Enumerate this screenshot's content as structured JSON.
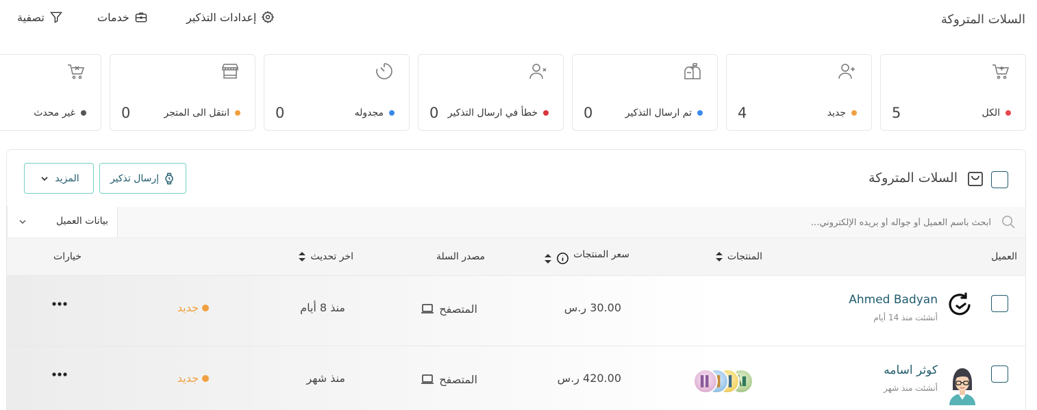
{
  "header": {
    "title": "السلات المتروكة",
    "actions": [
      {
        "label": "إعدادات التذكير",
        "icon": "gear-icon"
      },
      {
        "label": "خدمات",
        "icon": "briefcase-icon"
      },
      {
        "label": "تصفية",
        "icon": "filter-icon"
      }
    ]
  },
  "stats": [
    {
      "label": "الكل",
      "count": "5",
      "dot_color": "#e8474e",
      "icon": "cart-plus-icon"
    },
    {
      "label": "جديد",
      "count": "4",
      "dot_color": "#f0a040",
      "icon": "user-plus-icon"
    },
    {
      "label": "تم ارسال التذكير",
      "count": "0",
      "dot_color": "#3b8be6",
      "icon": "mailbox-icon"
    },
    {
      "label": "خطأ في ارسال التذكير",
      "count": "0",
      "dot_color": "#d9363e",
      "icon": "user-x-icon"
    },
    {
      "label": "مجدوله",
      "count": "0",
      "dot_color": "#3b8be6",
      "icon": "timer-icon"
    },
    {
      "label": "انتقل الى المتجر",
      "count": "0",
      "dot_color": "#f0a040",
      "icon": "store-icon"
    },
    {
      "label": "غير محدث",
      "count": "",
      "dot_color": "#555555",
      "icon": "cart-x-icon"
    }
  ],
  "panel": {
    "title": "السلات المتروكة",
    "send_reminder_label": "إرسال تذكير",
    "more_label": "المزيد",
    "search_placeholder": "ابحث باسم العميل أو جواله أو بريده الإلكتروني...",
    "filter_label": "بيانات العميل"
  },
  "columns": {
    "customer": "العميل",
    "products": "المنتجات",
    "price": "سعر المنتجات",
    "source": "مصدر السلة",
    "updated": "اخر تحديث",
    "options": "خيارات"
  },
  "rows": [
    {
      "name": "Ahmed Badyan",
      "created": "أنشئت منذ 14 أيام",
      "price": "30.00 ر.س",
      "source": "المتصفح",
      "updated": "منذ 8 أيام",
      "status": "جديد",
      "has_products": false
    },
    {
      "name": "كوثر اسامه",
      "created": "أنشئت منذ شهر",
      "price": "420.00 ر.س",
      "source": "المتصفح",
      "updated": "منذ شهر",
      "status": "جديد",
      "has_products": true
    }
  ]
}
